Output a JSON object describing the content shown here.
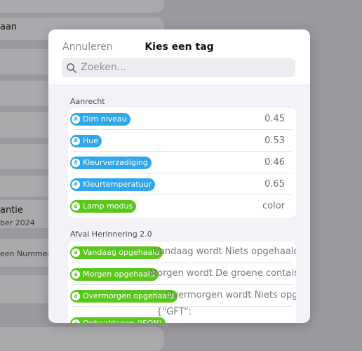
{
  "background": {
    "rows": [
      {
        "text": "aan"
      },
      {
        "text": "antie",
        "sub": "ber 2024"
      },
      {
        "sub": "een Nummer-ta"
      }
    ]
  },
  "modal": {
    "cancel_label": "Annuleren",
    "title": "Kies een tag",
    "search_placeholder": "Zoeken...",
    "sections": [
      {
        "title": "Aanrecht",
        "items": [
          {
            "icon": "#",
            "label": "Dim niveau",
            "value": "0.45",
            "color": "blue"
          },
          {
            "icon": "#",
            "label": "Hue",
            "value": "0.53",
            "color": "blue"
          },
          {
            "icon": "#",
            "label": "Kleurverzadiging",
            "value": "0.46",
            "color": "blue"
          },
          {
            "icon": "#",
            "label": "Kleurtemperatuur",
            "value": "0.65",
            "color": "blue"
          },
          {
            "icon": "a",
            "label": "Lamp modus",
            "value": "color",
            "color": "green"
          }
        ]
      },
      {
        "title": "Afval Herinnering 2.0",
        "items": [
          {
            "icon": "a",
            "label": "Vandaag opgehaald",
            "value": "Vandaag wordt Niets opgehaald.",
            "color": "green"
          },
          {
            "icon": "a",
            "label": "Morgen opgehaald",
            "value": "Morgen wordt De groene container op",
            "color": "green"
          },
          {
            "icon": "a",
            "label": "Overmorgen opgehaald",
            "value": "Overmorgen wordt Niets opgehaal",
            "color": "green"
          },
          {
            "icon": "a",
            "label": "Ophaaldagen (JSON)",
            "value": "{\"GFT\":",
            "color": "green"
          }
        ]
      }
    ]
  },
  "colors": {
    "tag_blue": "#2fa7e8",
    "tag_green": "#59c71b"
  }
}
